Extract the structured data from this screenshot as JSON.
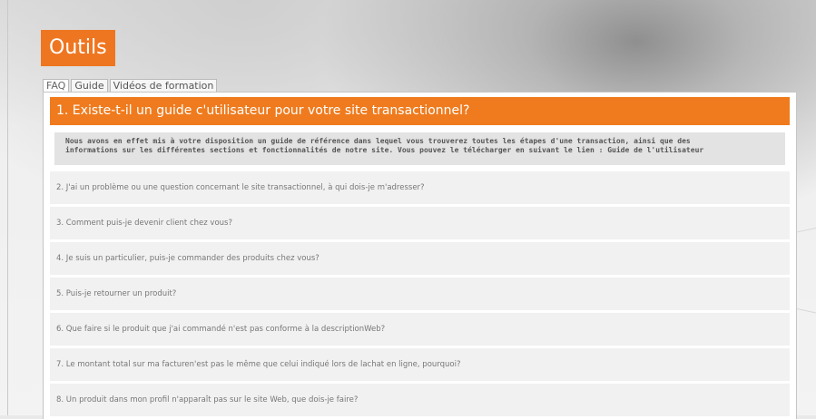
{
  "header": {
    "title": "Outils"
  },
  "tabs": [
    {
      "label": "FAQ",
      "active": true
    },
    {
      "label": "Guide",
      "active": false
    },
    {
      "label": "Vidéos de formation",
      "active": false
    }
  ],
  "faq": {
    "open_question": "1. Existe-t-il un guide c'utilisateur pour votre site transactionnel?",
    "open_answer_line1": "Nous avons en effet mis à votre disposition un guide de référence dans lequel vous trouverez toutes les étapes d'une transaction, ainsi que des",
    "open_answer_line2": "informations sur les différentes sections et fonctionnalités de notre site. Vous pouvez le télécharger en suivant le lien : Guide de l'utilisateur",
    "questions": [
      "2. J'ai un problème ou une question concernant le site transactionnel, à qui dois-je m'adresser?",
      "3. Comment puis-je devenir client chez vous?",
      "4. Je suis un particulier, puis-je commander des produits chez vous?",
      "5. Puis-je retourner un produit?",
      "6. Que faire si le produit que j'ai commandé n'est pas conforme à la descriptionWeb?",
      "7. Le montant total sur ma facturen'est pas le même que celui indiqué lors de lachat en ligne, pourquoi?",
      "8. Un produit dans mon profil n'apparaît pas sur le site Web, que dois-je faire?"
    ]
  },
  "colors": {
    "accent": "#ef7620",
    "item_bg": "#f1f1f1",
    "answer_bg": "#e3e3e3"
  }
}
